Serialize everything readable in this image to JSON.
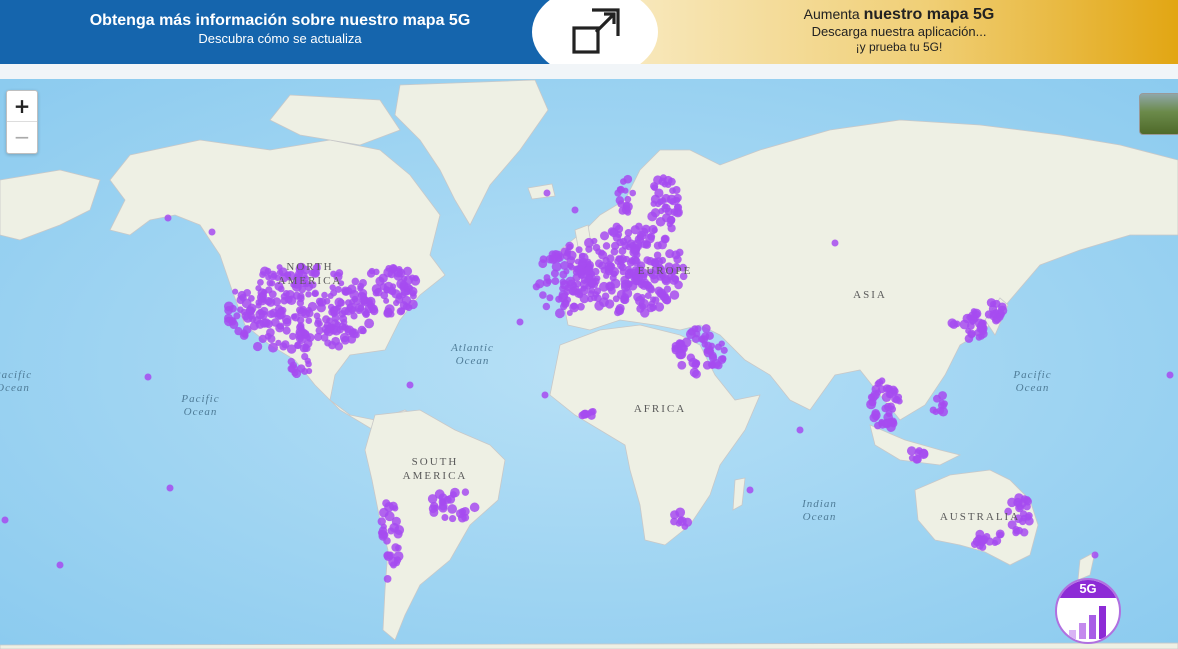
{
  "banner": {
    "left_title": "Obtenga más información sobre nuestro mapa 5G",
    "left_subtitle": "Descubra cómo se actualiza",
    "right_line1_prefix": "Aumenta ",
    "right_line1_bold": "nuestro mapa 5G",
    "right_line2": "Descarga nuestra aplicación...",
    "right_line3": "¡y prueba tu 5G!"
  },
  "icons": {
    "expand": "expand-icon",
    "zoom_in": "+",
    "zoom_out": "−",
    "basemap": "basemap-thumbnail-icon",
    "badge": "5g-signal-icon"
  },
  "zoom": {
    "in_label": "+",
    "out_label": "−"
  },
  "map": {
    "continents": [
      {
        "key": "north_america",
        "text": "NORTH AMERICA"
      },
      {
        "key": "south_america",
        "text": "SOUTH AMERICA"
      },
      {
        "key": "europe",
        "text": "EUROPE"
      },
      {
        "key": "asia",
        "text": "ASIA"
      },
      {
        "key": "africa",
        "text": "AFRICA"
      },
      {
        "key": "australia",
        "text": "AUSTRALIA"
      }
    ],
    "oceans": [
      {
        "key": "atlantic",
        "text": "Atlantic Ocean"
      },
      {
        "key": "pacific_west",
        "text": "Pacific Ocean"
      },
      {
        "key": "pacific_east",
        "text": "Pacific Ocean"
      },
      {
        "key": "pacific_far_left",
        "text": "Pacific Ocean"
      },
      {
        "key": "indian",
        "text": "Indian Ocean"
      }
    ]
  },
  "badge": {
    "label": "5G"
  },
  "colors": {
    "banner_blue": "#1565ad",
    "banner_gold": "#e2a613",
    "coverage": "#a64bf0",
    "ocean": "#a5d6f2",
    "land": "#eef0e4",
    "badge_purple": "#8d2bd6"
  }
}
